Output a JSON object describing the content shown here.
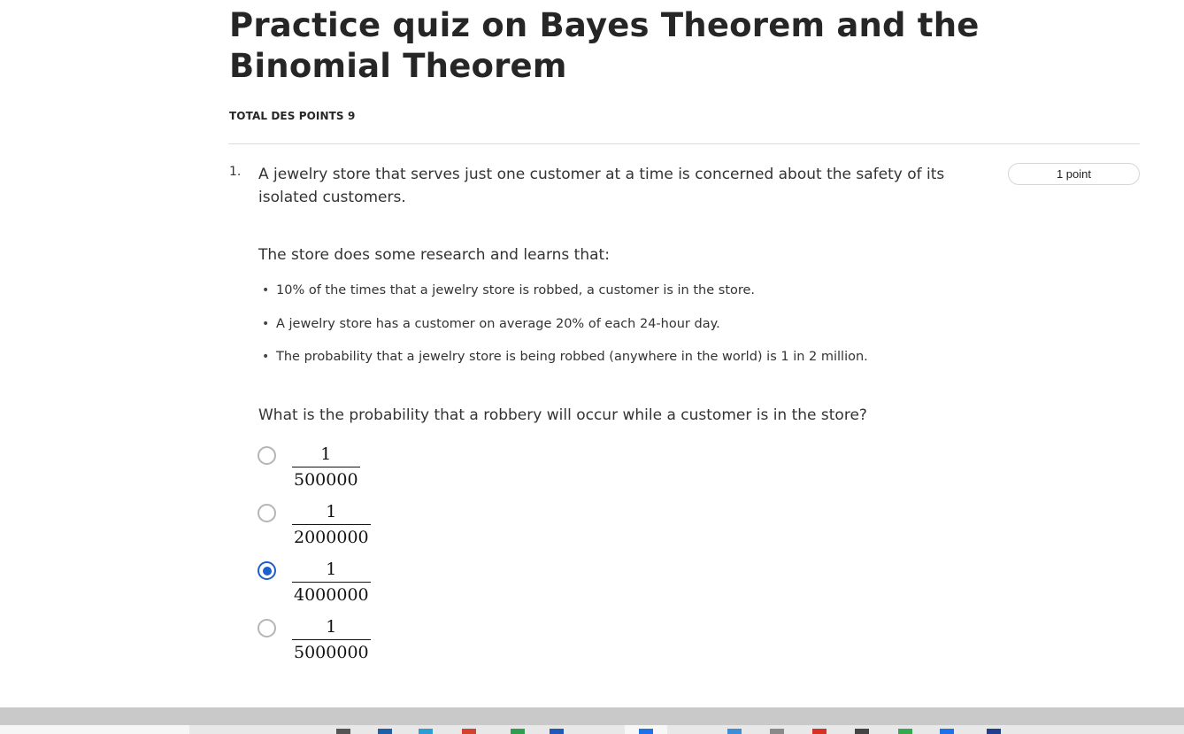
{
  "quiz": {
    "title": "Practice quiz on Bayes Theorem and the Binomial Theorem",
    "total_points": "TOTAL DES POINTS 9"
  },
  "question": {
    "number": "1.",
    "points": "1 point",
    "intro": "A jewelry store that serves just one customer at a time is concerned about the safety of its isolated customers.",
    "lead": "The store does some research and learns that:",
    "facts": [
      "10% of the times that a jewelry store is robbed, a customer is in the store.",
      "A jewelry store has a customer on average 20% of each 24-hour day.",
      "The probability that a jewelry store is being robbed (anywhere in the world) is 1 in 2 million."
    ],
    "ask": "What is the probability that a robbery will occur while a customer is in the store?",
    "options": [
      {
        "numerator": "1",
        "denominator": "500000",
        "selected": false
      },
      {
        "numerator": "1",
        "denominator": "2000000",
        "selected": false
      },
      {
        "numerator": "1",
        "denominator": "4000000",
        "selected": true
      },
      {
        "numerator": "1",
        "denominator": "5000000",
        "selected": false
      }
    ]
  },
  "colors": {
    "accent": "#1c5fd0",
    "title": "#262626",
    "divider": "#dcdcdc"
  },
  "taskbar": {
    "icons": [
      {
        "name": "pen-icon",
        "color": "#555555"
      },
      {
        "name": "diamond-app-icon",
        "color": "#1f5fa8"
      },
      {
        "name": "blue-app-icon",
        "color": "#2a9fd6"
      },
      {
        "name": "red-app-icon",
        "color": "#d4412e"
      },
      {
        "name": "green-app-icon",
        "color": "#2e9e4f"
      },
      {
        "name": "word-app-icon",
        "color": "#1e5bb8"
      },
      {
        "name": "browser-icon",
        "color": "#1a73e8"
      },
      {
        "name": "mail-icon",
        "color": "#3b8fd9"
      },
      {
        "name": "folder-icon",
        "color": "#8a8a8a"
      },
      {
        "name": "red-circle-icon",
        "color": "#d93025"
      },
      {
        "name": "window-icon",
        "color": "#444444"
      },
      {
        "name": "green-circle-icon",
        "color": "#34a853"
      },
      {
        "name": "blue-square-icon",
        "color": "#1a73e8"
      },
      {
        "name": "navy-app-icon",
        "color": "#1f3f8f"
      }
    ]
  }
}
